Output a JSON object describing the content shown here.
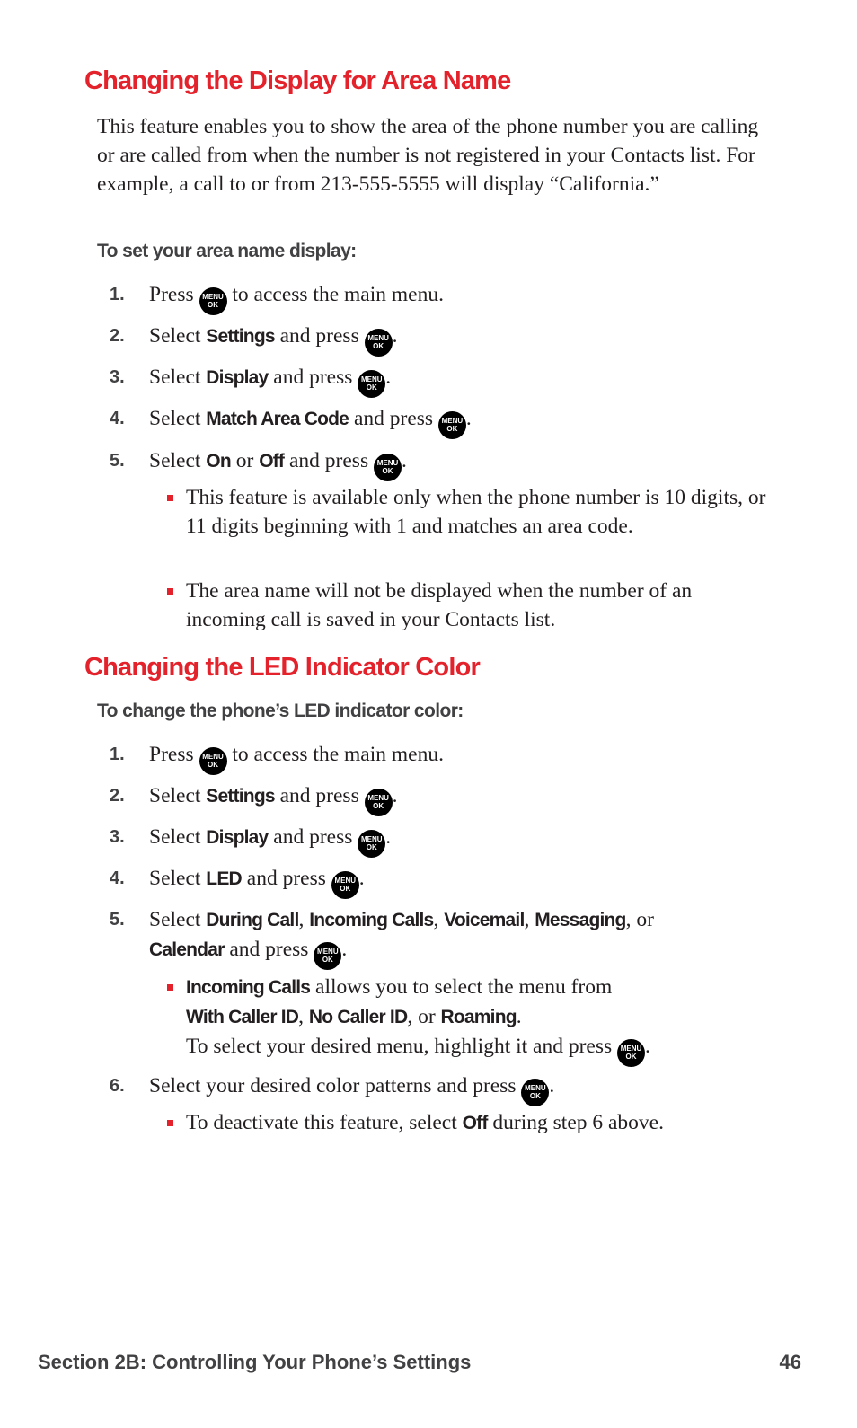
{
  "section1": {
    "title": "Changing the Display for Area Name",
    "intro": "This feature enables you to show the area of the phone number you are calling or are called from when the number is not registered in your Contacts list. For example, a call to or from 213-555-5555 will display “California.”",
    "subhead": "To set your area name display:",
    "steps": [
      {
        "num": "1.",
        "pre": "Press ",
        "post": " to access the main menu."
      },
      {
        "num": "2.",
        "pre": "Select ",
        "b1": "Settings",
        "mid": " and press ",
        "post": "."
      },
      {
        "num": "3.",
        "pre": "Select ",
        "b1": "Display",
        "mid": " and press ",
        "post": "."
      },
      {
        "num": "4.",
        "pre": "Select ",
        "b1": "Match Area Code",
        "mid": " and press ",
        "post": "."
      },
      {
        "num": "5.",
        "pre": "Select ",
        "b1": "On",
        "or": " or ",
        "b2": "Off",
        "mid": " and press ",
        "post": "."
      }
    ],
    "bullets": [
      "This feature is available only when the phone number is 10 digits, or 11 digits beginning with 1 and matches an area code.",
      "The area name will not be displayed when the number of an incoming call is saved in your Contacts list."
    ]
  },
  "section2": {
    "title": "Changing the LED Indicator Color",
    "subhead": "To change the phone’s LED indicator color:",
    "steps": [
      {
        "num": "1.",
        "pre": "Press ",
        "post": " to access the main menu."
      },
      {
        "num": "2.",
        "pre": "Select ",
        "b1": "Settings",
        "mid": " and press ",
        "post": "."
      },
      {
        "num": "3.",
        "pre": "Select ",
        "b1": "Display",
        "mid": " and press ",
        "post": "."
      },
      {
        "num": "4.",
        "pre": "Select ",
        "b1": "LED",
        "mid": " and press ",
        "post": "."
      },
      {
        "num": "5.",
        "pre": "Select ",
        "b1": "During Call",
        "c1": ", ",
        "b2": "Incoming Calls",
        "c2": ", ",
        "b3": "Voicemail",
        "c3": ", ",
        "b4": "Messaging",
        "c4": ", or ",
        "b5": "Calendar",
        "mid": " and press ",
        "post": "."
      },
      {
        "num": "6.",
        "pre": "Select your desired color patterns and press ",
        "post": "."
      }
    ],
    "bullet5": {
      "b1": "Incoming Calls",
      "t1": " allows you to select the menu from ",
      "b2": "With Caller ID",
      "c1": ", ",
      "b3": "No Caller ID",
      "c2": ", or ",
      "b4": "Roaming",
      "t2": ".",
      "line3": "To select your desired menu, highlight it and press ",
      "post": "."
    },
    "bullet6": {
      "pre": "To deactivate this feature, select ",
      "b1": "Off",
      "post": " during step 6 above."
    }
  },
  "menu_key": {
    "top": "MENU",
    "bottom": "OK",
    "icon": "menu-ok-key-icon"
  },
  "footer": {
    "section": "Section 2B: Controlling Your Phone’s Settings",
    "page": "46"
  },
  "colors": {
    "heading": "#e3222b",
    "bullet": "#e3222b",
    "key": "#000000"
  }
}
